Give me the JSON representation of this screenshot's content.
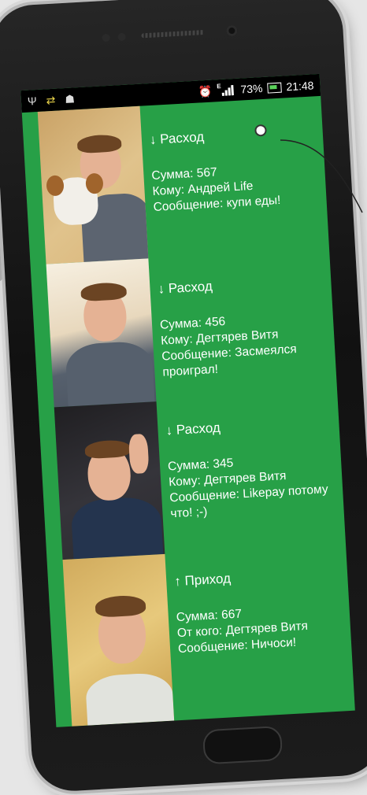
{
  "status_bar": {
    "left_icons": [
      "usb-icon",
      "sim-transfer-icon",
      "android-debug-icon"
    ],
    "alarm_icon": "alarm-clock-icon",
    "network_type": "E",
    "battery_percent": "73%",
    "time": "21:48"
  },
  "transactions": [
    {
      "direction_icon": "↓",
      "type": "Расход",
      "amount": "Сумма: 567",
      "party": "Кому: Андрей Life",
      "message": "Сообщение: купи еды!",
      "message_extra": ""
    },
    {
      "direction_icon": "↓",
      "type": "Расход",
      "amount": "Сумма: 456",
      "party": "Кому: Дегтярев Витя",
      "message": "Сообщение: Засмеялся",
      "message_extra": "проиграл!"
    },
    {
      "direction_icon": "↓",
      "type": "Расход",
      "amount": "Сумма: 345",
      "party": "Кому: Дегтярев Витя",
      "message": "Сообщение: Likepay потому",
      "message_extra": "что! ;-)"
    },
    {
      "direction_icon": "↑",
      "type": "Приход",
      "amount": "Сумма: 667",
      "party": "От кого: Дегтярев Витя",
      "message": "Сообщение: Ничоси!",
      "message_extra": ""
    }
  ],
  "colors": {
    "accent": "#27a047"
  }
}
